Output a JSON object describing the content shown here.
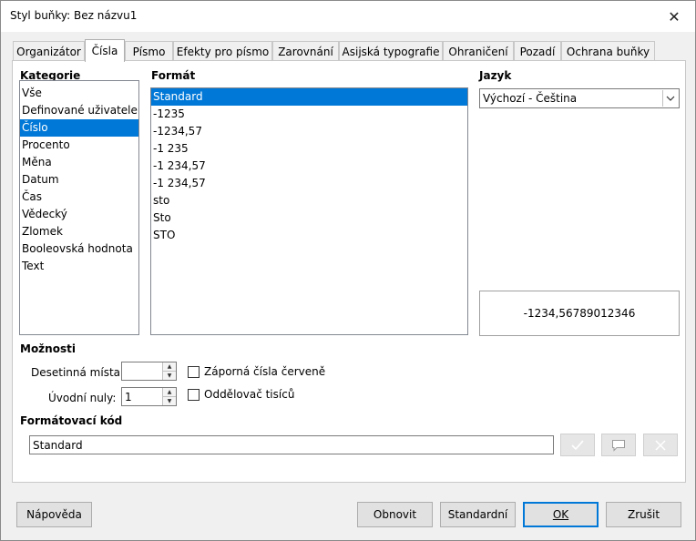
{
  "window": {
    "title": "Styl buňky: Bez názvu1"
  },
  "tabs": [
    {
      "label": "Organizátor"
    },
    {
      "label": "Čísla"
    },
    {
      "label": "Písmo"
    },
    {
      "label": "Efekty pro písmo"
    },
    {
      "label": "Zarovnání"
    },
    {
      "label": "Asijská typografie"
    },
    {
      "label": "Ohraničení"
    },
    {
      "label": "Pozadí"
    },
    {
      "label": "Ochrana buňky"
    }
  ],
  "active_tab": "Čísla",
  "category": {
    "heading": "Kategorie",
    "items": [
      "Vše",
      "Definované uživatelem",
      "Číslo",
      "Procento",
      "Měna",
      "Datum",
      "Čas",
      "Vědecký",
      "Zlomek",
      "Booleovská hodnota",
      "Text"
    ],
    "selected": "Číslo"
  },
  "format": {
    "heading": "Formát",
    "items": [
      "Standard",
      "-1235",
      "-1234,57",
      "-1 235",
      "-1 234,57",
      "-1 234,57",
      "sto",
      "Sto",
      "STO"
    ],
    "selected": "Standard"
  },
  "language": {
    "heading": "Jazyk",
    "selected": "Výchozí - Čeština"
  },
  "preview": {
    "text": "-1234,56789012346"
  },
  "options": {
    "heading": "Možnosti",
    "decimal_places_label": "Desetinná místa:",
    "decimal_places_value": "",
    "leading_zeros_label": "Úvodní nuly:",
    "leading_zeros_value": "1",
    "negative_red_label": "Záporná čísla červeně",
    "negative_red_checked": false,
    "thousands_sep_label": "Oddělovač tisíců",
    "thousands_sep_checked": false
  },
  "format_code": {
    "heading": "Formátovací kód",
    "value": "Standard"
  },
  "buttons": {
    "help": "Nápověda",
    "reset": "Obnovit",
    "standard": "Standardní",
    "ok": "OK",
    "cancel": "Zrušit"
  }
}
